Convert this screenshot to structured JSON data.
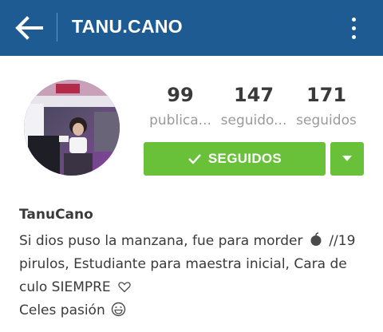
{
  "header": {
    "title": "TANU.CANO",
    "background": "#1d5b92",
    "back_icon": "arrow-left-icon",
    "menu_icon": "more-vertical-icon"
  },
  "profile": {
    "stats": [
      {
        "value": "99",
        "label": "publica..."
      },
      {
        "value": "147",
        "label": "seguido..."
      },
      {
        "value": "171",
        "label": "seguidos"
      }
    ],
    "follow_button_label": "SEGUIDOS",
    "follow_button_color": "#69c13a",
    "follow_icon": "check-icon",
    "dropdown_icon": "caret-down-icon",
    "username": "TanuCano",
    "bio": {
      "line1_a": "Si dios puso la manzana, fue para morder",
      "line1_b": "//19",
      "line2": "pirulos, Estudiante para maestra inicial, Cara de",
      "line3": "culo SIEMPRE",
      "line4": "Celes pasión"
    }
  }
}
